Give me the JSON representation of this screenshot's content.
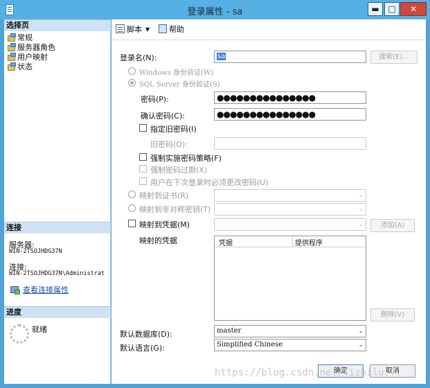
{
  "window": {
    "title": "登录属性 - sa",
    "minimize_glyph": "▬",
    "maximize_glyph": "□",
    "close_glyph": "✕"
  },
  "sidebar": {
    "select_page_header": "选择页",
    "items": [
      {
        "label": "常规",
        "icon": "page-icon"
      },
      {
        "label": "服务器角色",
        "icon": "page-icon"
      },
      {
        "label": "用户映射",
        "icon": "page-icon"
      },
      {
        "label": "状态",
        "icon": "page-icon"
      }
    ],
    "connection_header": "连接",
    "server_label": "服务器:",
    "server_value": "WIN-2TSOJHDG37N",
    "connection_label": "连接:",
    "connection_value": "WIN-2TSOJHDG37N\\Administrat",
    "view_connection_link": "查看连接属性",
    "progress_header": "进度",
    "progress_status": "就绪"
  },
  "toolbar": {
    "script_label": "脚本",
    "script_caret": "▼",
    "help_label": "帮助"
  },
  "form": {
    "login_name_label": "登录名(N):",
    "login_name_value": "sa",
    "search_button": "搜索(E)...",
    "windows_auth_label": "Windows 身份验证(W)",
    "sql_auth_label": "SQL Server 身份验证(S)",
    "password_label": "密码(P):",
    "password_value": "●●●●●●●●●●●●●●●",
    "confirm_password_label": "确认密码(C):",
    "confirm_password_value": "●●●●●●●●●●●●●●●",
    "specify_old_password_label": "指定旧密码(I)",
    "old_password_label": "旧密码(O):",
    "enforce_policy_label": "强制实施密码策略(F)",
    "enforce_expiration_label": "强制密码过期(X)",
    "must_change_label": "用户在下次登录时必须更改密码(U)",
    "map_certificate_label": "映射到证书(R)",
    "map_asymmetric_key_label": "映射到非对称密钥(T)",
    "map_credential_label": "映射到凭据(M)",
    "add_button": "添加(A)",
    "mapped_credentials_label": "映射的凭据",
    "grid_columns": [
      "凭据",
      "提供程序"
    ],
    "remove_button": "删除(V)",
    "default_database_label": "默认数据库(D):",
    "default_database_value": "master",
    "default_language_label": "默认语言(G):",
    "default_language_value": "Simplified Chinese",
    "select_caret": "⌄"
  },
  "footer": {
    "ok_button": "确定",
    "cancel_button": "取消"
  },
  "watermark": "https://blog.csdn.net/lizhilu..."
}
